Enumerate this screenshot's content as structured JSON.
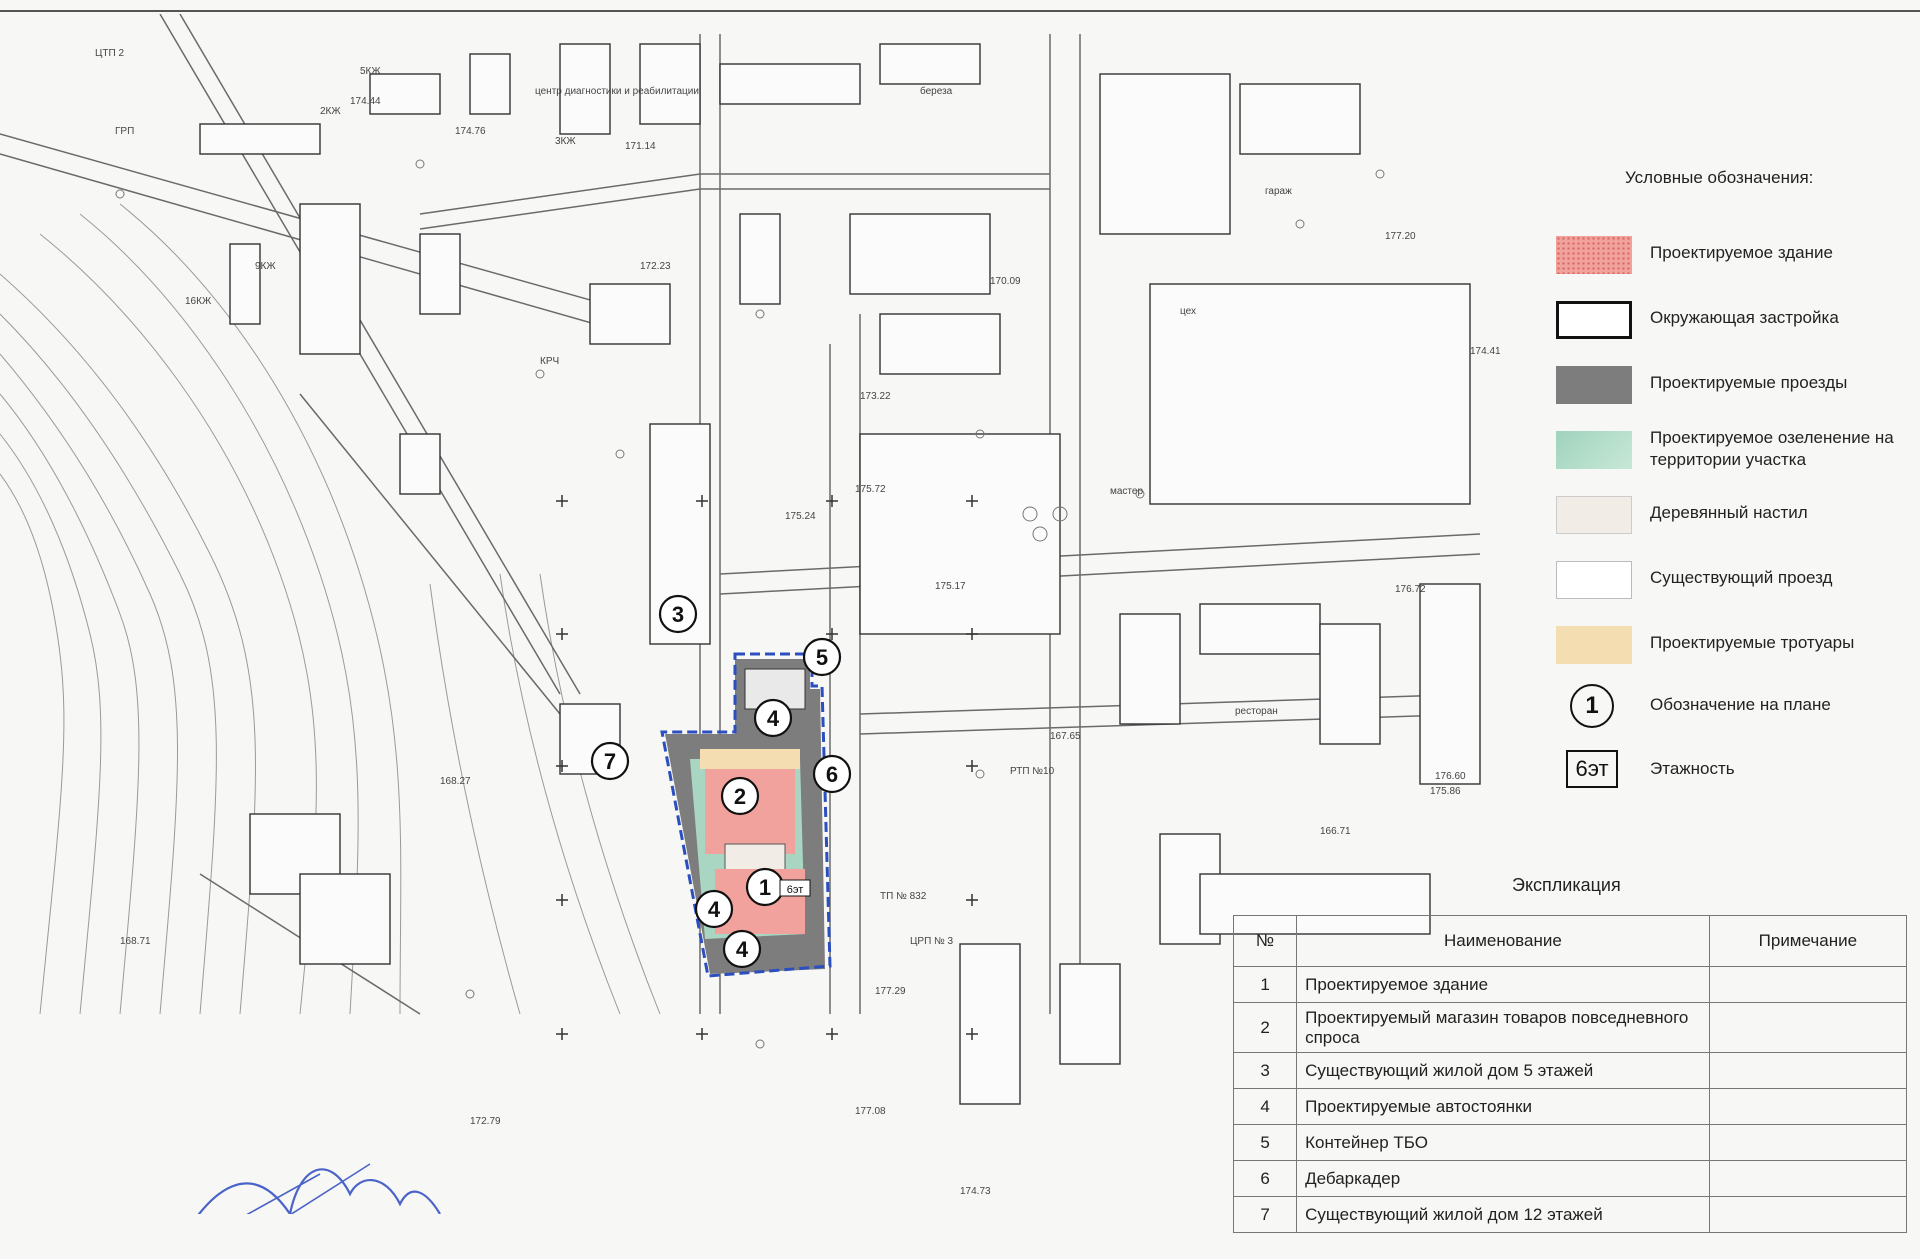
{
  "legend": {
    "title": "Условные обозначения:",
    "items": [
      {
        "key": "proposed-building",
        "label": "Проектируемое здание",
        "color": "#f2a29d"
      },
      {
        "key": "surrounding-buildings",
        "label": "Окружающая застройка",
        "color": "#ffffff"
      },
      {
        "key": "proposed-driveways",
        "label": "Проектируемые проезды",
        "color": "#7d7d7d"
      },
      {
        "key": "proposed-greening",
        "label": "Проектируемое озеленение на территории участка",
        "color": "#a9d6c3"
      },
      {
        "key": "wooden-deck",
        "label": "Деревянный настил",
        "color": "#f1ede6"
      },
      {
        "key": "existing-driveway",
        "label": "Существующий проезд",
        "color": "#ffffff"
      },
      {
        "key": "proposed-sidewalks",
        "label": "Проектируемые тротуары",
        "color": "#f5ddb2"
      },
      {
        "key": "plan-marker",
        "label": "Обозначение на плане",
        "symbol": "1"
      },
      {
        "key": "storeys",
        "label": "Этажность",
        "symbol": "6эт"
      }
    ]
  },
  "explication": {
    "title": "Экспликация",
    "headers": {
      "num": "№",
      "name": "Наименование",
      "note": "Примечание"
    },
    "rows": [
      {
        "num": "1",
        "name": "Проектируемое здание",
        "note": ""
      },
      {
        "num": "2",
        "name": "Проектируемый магазин товаров повседневного спроса",
        "note": ""
      },
      {
        "num": "3",
        "name": "Существующий жилой дом 5 этажей",
        "note": ""
      },
      {
        "num": "4",
        "name": "Проектируемые автостоянки",
        "note": ""
      },
      {
        "num": "5",
        "name": "Контейнер ТБО",
        "note": ""
      },
      {
        "num": "6",
        "name": "Дебаркадер",
        "note": ""
      },
      {
        "num": "7",
        "name": "Существующий жилой дом 12 этажей",
        "note": ""
      }
    ]
  },
  "map": {
    "markers": [
      "1",
      "2",
      "3",
      "4",
      "4",
      "4",
      "5",
      "6",
      "7"
    ],
    "map_labels": [
      "ЦТП 2",
      "ГРП",
      "2КЖ",
      "3КЖ",
      "5КЖ",
      "16КЖ",
      "9КЖ",
      "ЦРП № 3",
      "ТП № 832",
      "РТП №10",
      "ресторан",
      "мастер",
      "цех",
      "гараж",
      "центр диагностики и реабилитации",
      "КРЧ",
      "береза",
      "171.14",
      "174.76",
      "172.23",
      "170.09",
      "173.22",
      "175.72",
      "175.24",
      "175.17",
      "174.41",
      "175.86",
      "176.72",
      "176.60",
      "177.20",
      "177.29",
      "177.08",
      "174.73",
      "172.79",
      "174.44",
      "168.27",
      "168.71",
      "167.65",
      "166.71"
    ],
    "site_label": "6эт",
    "colors": {
      "building": "#f2a29d",
      "driveway": "#7d7d7d",
      "greening": "#a9d6c3",
      "sidewalk": "#f5ddb2",
      "boundary": "#2b4fbf"
    }
  }
}
